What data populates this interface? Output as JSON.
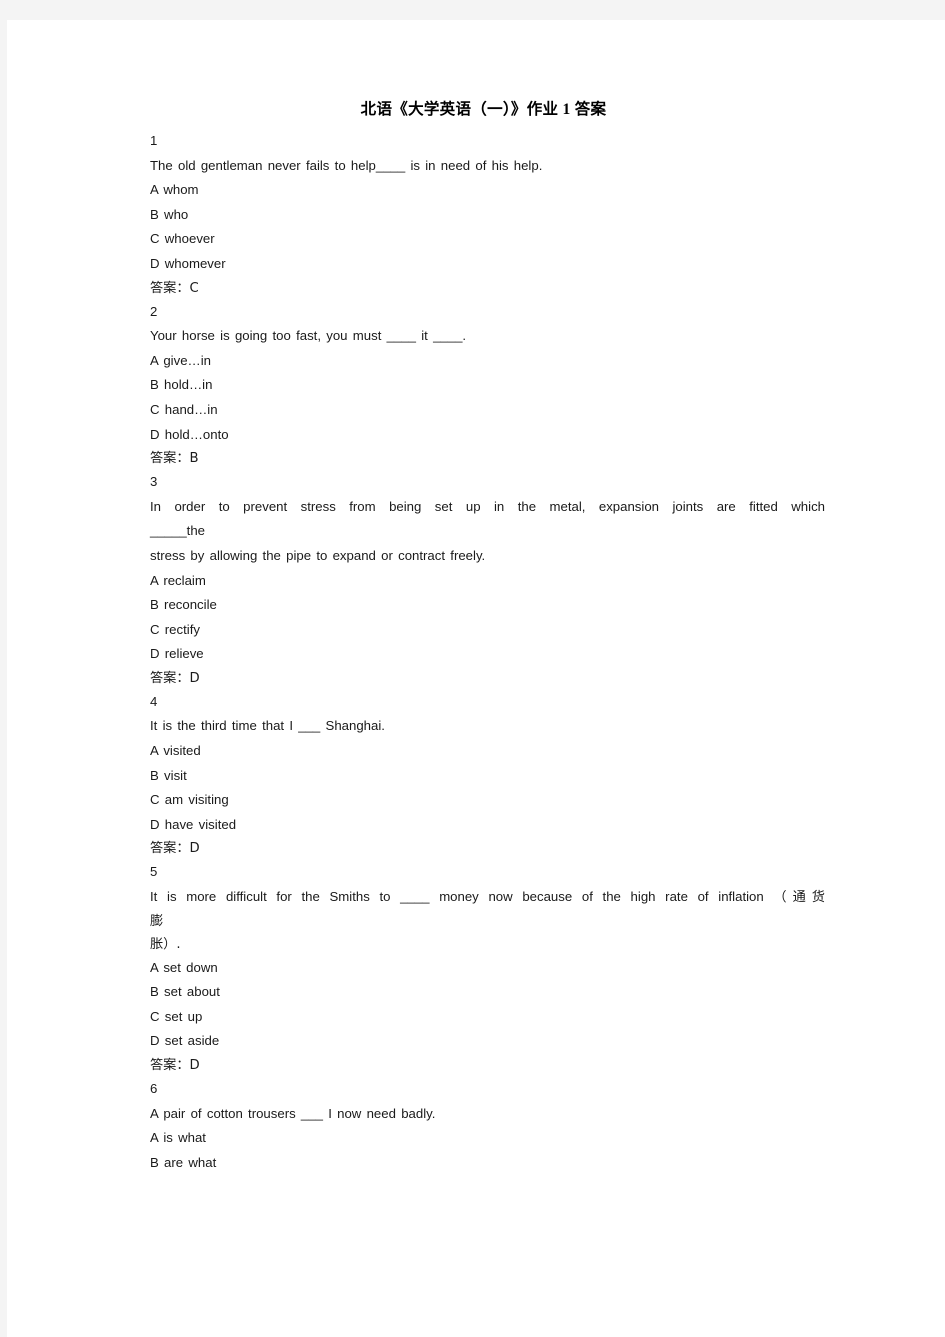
{
  "document": {
    "title": "北语《大学英语（一）》作业 1 答案",
    "answer_label": "答案：",
    "lines": [
      {
        "id": "q1-num",
        "text": "1"
      },
      {
        "id": "q1-stem",
        "text": "The old gentleman never fails to help____ is in need of his help."
      },
      {
        "id": "q1-opt-a",
        "text": "A whom"
      },
      {
        "id": "q1-opt-b",
        "text": "B who"
      },
      {
        "id": "q1-opt-c",
        "text": "C whoever"
      },
      {
        "id": "q1-opt-d",
        "text": "D whomever"
      },
      {
        "id": "q1-answer",
        "text": "答案：C"
      },
      {
        "id": "q2-num",
        "text": "2"
      },
      {
        "id": "q2-stem",
        "text": "Your horse is going too fast, you must ____ it ____."
      },
      {
        "id": "q2-opt-a",
        "text": "A give…in"
      },
      {
        "id": "q2-opt-b",
        "text": "B hold…in"
      },
      {
        "id": "q2-opt-c",
        "text": "C hand…in"
      },
      {
        "id": "q2-opt-d",
        "text": "D hold…onto"
      },
      {
        "id": "q2-answer",
        "text": "答案：B"
      },
      {
        "id": "q3-num",
        "text": "3"
      },
      {
        "id": "q3-stem-1",
        "text": "In order to prevent stress from being set up in the metal, expansion joints are fitted which"
      },
      {
        "id": "q3-stem-2",
        "text": "_____the"
      },
      {
        "id": "q3-stem-3",
        "text": "stress by allowing the pipe to expand or contract freely."
      },
      {
        "id": "q3-opt-a",
        "text": "A reclaim"
      },
      {
        "id": "q3-opt-b",
        "text": "B reconcile"
      },
      {
        "id": "q3-opt-c",
        "text": "C rectify"
      },
      {
        "id": "q3-opt-d",
        "text": "D relieve"
      },
      {
        "id": "q3-answer",
        "text": "答案：D"
      },
      {
        "id": "q4-num",
        "text": "4"
      },
      {
        "id": "q4-stem",
        "text": "It is the third time that I ___ Shanghai."
      },
      {
        "id": "q4-opt-a",
        "text": "A visited"
      },
      {
        "id": "q4-opt-b",
        "text": "B visit"
      },
      {
        "id": "q4-opt-c",
        "text": "C am visiting"
      },
      {
        "id": "q4-opt-d",
        "text": "D have visited"
      },
      {
        "id": "q4-answer",
        "text": "答案：D"
      },
      {
        "id": "q5-num",
        "text": "5"
      },
      {
        "id": "q5-stem-1",
        "text": "It is more difficult for the Smiths to ____ money now because of the high rate of inflation （通货"
      },
      {
        "id": "q5-stem-2",
        "text": "膨"
      },
      {
        "id": "q5-stem-3",
        "text": "胀）."
      },
      {
        "id": "q5-opt-a",
        "text": "A set down"
      },
      {
        "id": "q5-opt-b",
        "text": "B set about"
      },
      {
        "id": "q5-opt-c",
        "text": "C set up"
      },
      {
        "id": "q5-opt-d",
        "text": "D set aside"
      },
      {
        "id": "q5-answer",
        "text": "答案：D"
      },
      {
        "id": "q6-num",
        "text": "6"
      },
      {
        "id": "q6-stem",
        "text": "A pair of cotton trousers ___ I now need badly."
      },
      {
        "id": "q6-opt-a",
        "text": "A is what"
      },
      {
        "id": "q6-opt-b",
        "text": "B are what"
      }
    ]
  },
  "questions": [
    {
      "number": "1",
      "stem": "The old gentleman never fails to help____ is in need of his help.",
      "options": [
        "A whom",
        "B who",
        "C whoever",
        "D whomever"
      ],
      "answer": "C"
    },
    {
      "number": "2",
      "stem": "Your horse is going too fast, you must ____ it ____.",
      "options": [
        "A give…in",
        "B hold…in",
        "C hand…in",
        "D hold…onto"
      ],
      "answer": "B"
    },
    {
      "number": "3",
      "stem": "In order to prevent stress from being set up in the metal, expansion joints are fitted which _____the stress by allowing the pipe to expand or contract freely.",
      "options": [
        "A reclaim",
        "B reconcile",
        "C rectify",
        "D relieve"
      ],
      "answer": "D"
    },
    {
      "number": "4",
      "stem": "It is the third time that I ___ Shanghai.",
      "options": [
        "A visited",
        "B visit",
        "C am visiting",
        "D have visited"
      ],
      "answer": "D"
    },
    {
      "number": "5",
      "stem": "It is more difficult for the Smiths to ____ money now because of the high rate of inflation （通货膨胀）.",
      "options": [
        "A set down",
        "B set about",
        "C set up",
        "D set aside"
      ],
      "answer": "D"
    },
    {
      "number": "6",
      "stem": "A pair of cotton trousers ___ I now need badly.",
      "options": [
        "A is what",
        "B are what"
      ],
      "answer": ""
    }
  ],
  "colors": {
    "page_background": "#ffffff",
    "canvas_background": "#f4f4f4",
    "text": "#1a1a1a",
    "title": "#000000"
  }
}
